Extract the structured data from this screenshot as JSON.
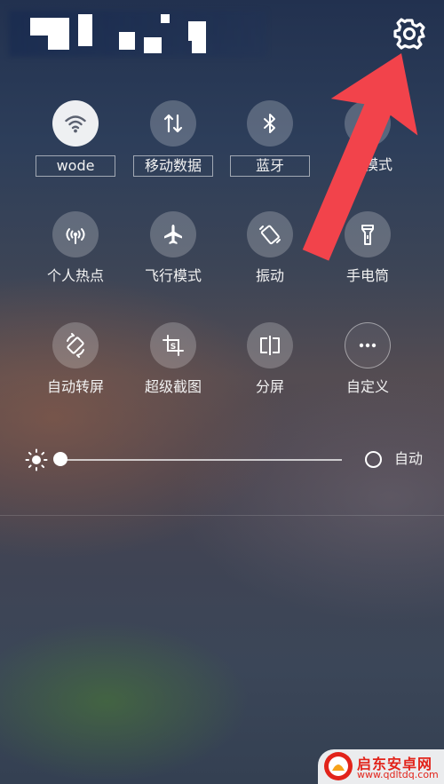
{
  "status_bar": {
    "settings_icon": "gear-icon"
  },
  "tiles": [
    {
      "id": "wifi",
      "label": "wode",
      "icon": "wifi-icon",
      "active": true,
      "boxed": true
    },
    {
      "id": "mobile-data",
      "label": "移动数据",
      "icon": "data-arrows-icon",
      "active": false,
      "boxed": true
    },
    {
      "id": "bluetooth",
      "label": "蓝牙",
      "icon": "bluetooth-icon",
      "active": false,
      "boxed": true
    },
    {
      "id": "mode",
      "label": "模式",
      "icon": "mode-icon",
      "active": false,
      "boxed": false
    },
    {
      "id": "hotspot",
      "label": "个人热点",
      "icon": "hotspot-icon",
      "active": false
    },
    {
      "id": "airplane",
      "label": "飞行模式",
      "icon": "airplane-icon",
      "active": false
    },
    {
      "id": "vibrate",
      "label": "振动",
      "icon": "vibrate-icon",
      "active": false
    },
    {
      "id": "flashlight",
      "label": "手电筒",
      "icon": "flashlight-icon",
      "active": false
    },
    {
      "id": "auto-rotate",
      "label": "自动转屏",
      "icon": "rotate-icon",
      "active": false
    },
    {
      "id": "screenshot",
      "label": "超级截图",
      "icon": "screenshot-icon",
      "active": false
    },
    {
      "id": "split-screen",
      "label": "分屏",
      "icon": "split-screen-icon",
      "active": false
    },
    {
      "id": "customize",
      "label": "自定义",
      "icon": "more-dots-icon",
      "active": false
    }
  ],
  "brightness": {
    "level": 0.0,
    "auto_label": "自动",
    "sun_icon": "sun-icon"
  },
  "watermark": {
    "title": "启东安卓网",
    "url": "www.qdltdq.com"
  },
  "colors": {
    "arrow": "#f2434b",
    "tile_bg": "rgba(255,255,255,0.22)",
    "active_tile_bg": "#ffffff"
  }
}
